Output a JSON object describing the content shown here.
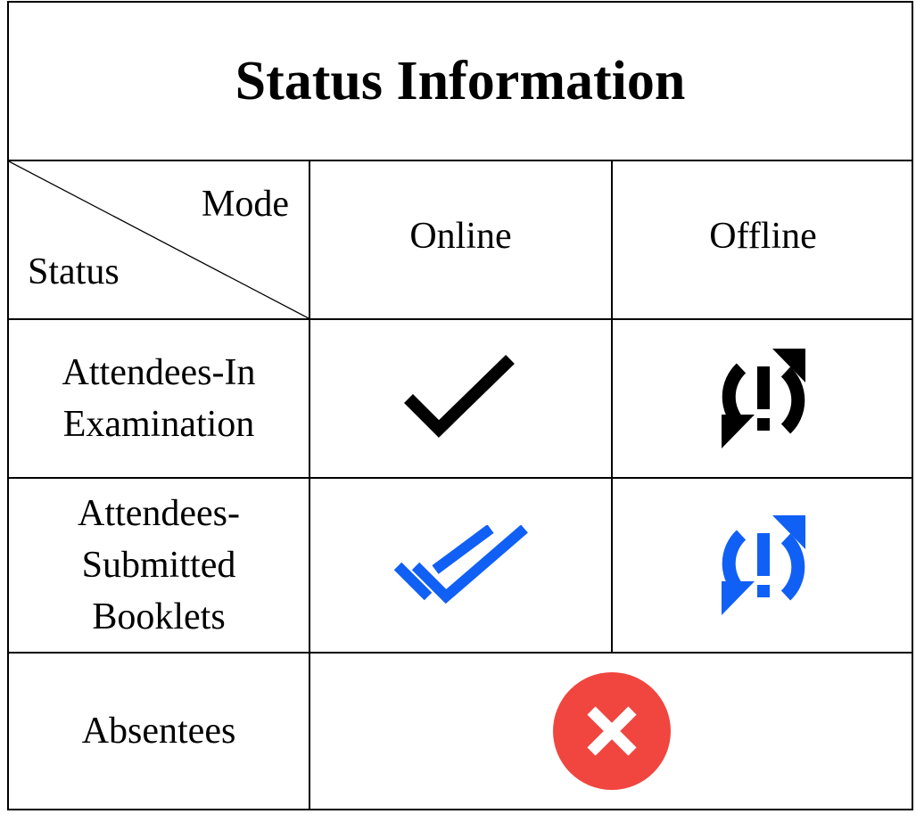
{
  "title": "Status Information",
  "header": {
    "corner_top": "Mode",
    "corner_bottom": "Status",
    "columns": [
      "Online",
      "Offline"
    ]
  },
  "rows": [
    {
      "label": "Attendees-In Examination",
      "online_icon": "check-icon",
      "offline_icon": "sync-alert-icon"
    },
    {
      "label_lines": [
        "Attendees-",
        "Submitted",
        "Booklets"
      ],
      "online_icon": "double-check-icon",
      "offline_icon": "sync-alert-icon"
    },
    {
      "label": "Absentees",
      "icon": "cancel-circle-icon"
    }
  ],
  "colors": {
    "black": "#000000",
    "submitted_blue": "#1160f5",
    "absent_red": "#f0463f"
  }
}
